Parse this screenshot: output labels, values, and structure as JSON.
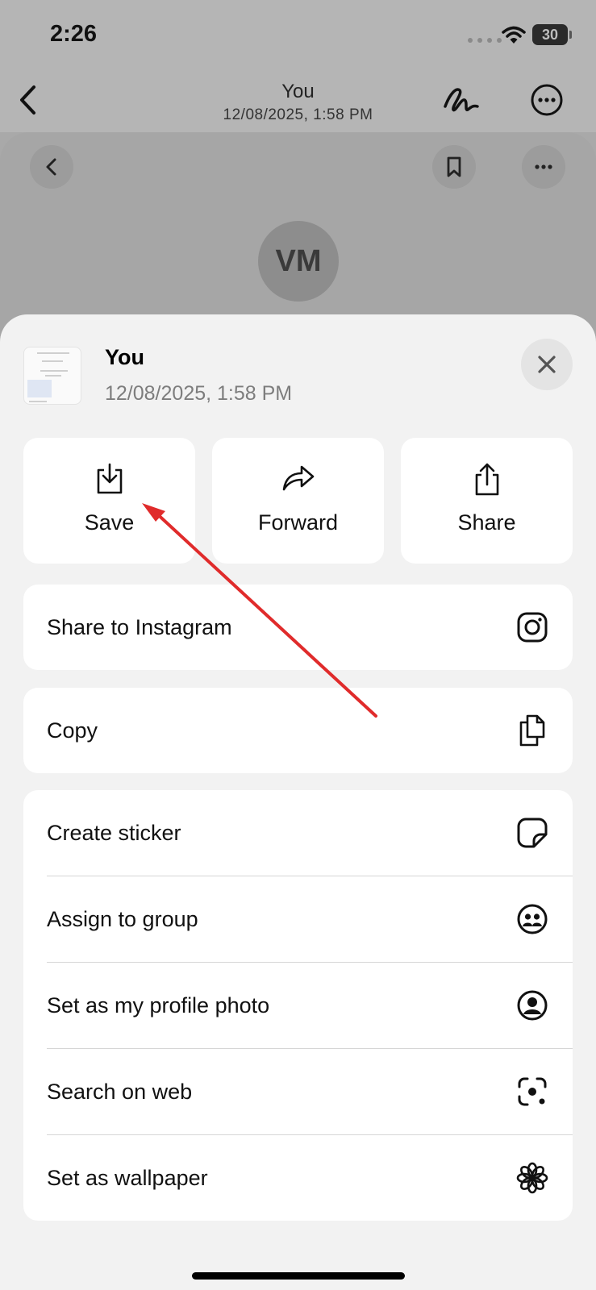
{
  "status_bar": {
    "time": "2:26",
    "battery": "30"
  },
  "chat_header": {
    "title": "You",
    "subtitle": "12/08/2025, 1:58 PM",
    "icons": [
      "chevron-left-icon",
      "signature-icon",
      "more-icon"
    ]
  },
  "viewer": {
    "avatar_initials": "VM",
    "icons": [
      "chevron-left-icon",
      "bookmark-icon",
      "more-icon"
    ]
  },
  "sheet": {
    "title": "You",
    "subtitle": "12/08/2025, 1:58 PM",
    "actions": [
      {
        "label": "Save",
        "icon": "save-download-icon"
      },
      {
        "label": "Forward",
        "icon": "forward-icon"
      },
      {
        "label": "Share",
        "icon": "share-icon"
      }
    ],
    "share_instagram": {
      "label": "Share to Instagram",
      "icon": "instagram-icon"
    },
    "copy": {
      "label": "Copy",
      "icon": "copy-icon"
    },
    "menu": [
      {
        "label": "Create sticker",
        "icon": "sticker-icon"
      },
      {
        "label": "Assign to group",
        "icon": "group-icon"
      },
      {
        "label": "Set as my profile photo",
        "icon": "profile-icon"
      },
      {
        "label": "Search on web",
        "icon": "visual-search-icon"
      },
      {
        "label": "Set as wallpaper",
        "icon": "wallpaper-flower-icon"
      }
    ]
  },
  "colors": {
    "annotation_arrow": "#e02b2b",
    "sheet_background": "#f2f2f2"
  }
}
